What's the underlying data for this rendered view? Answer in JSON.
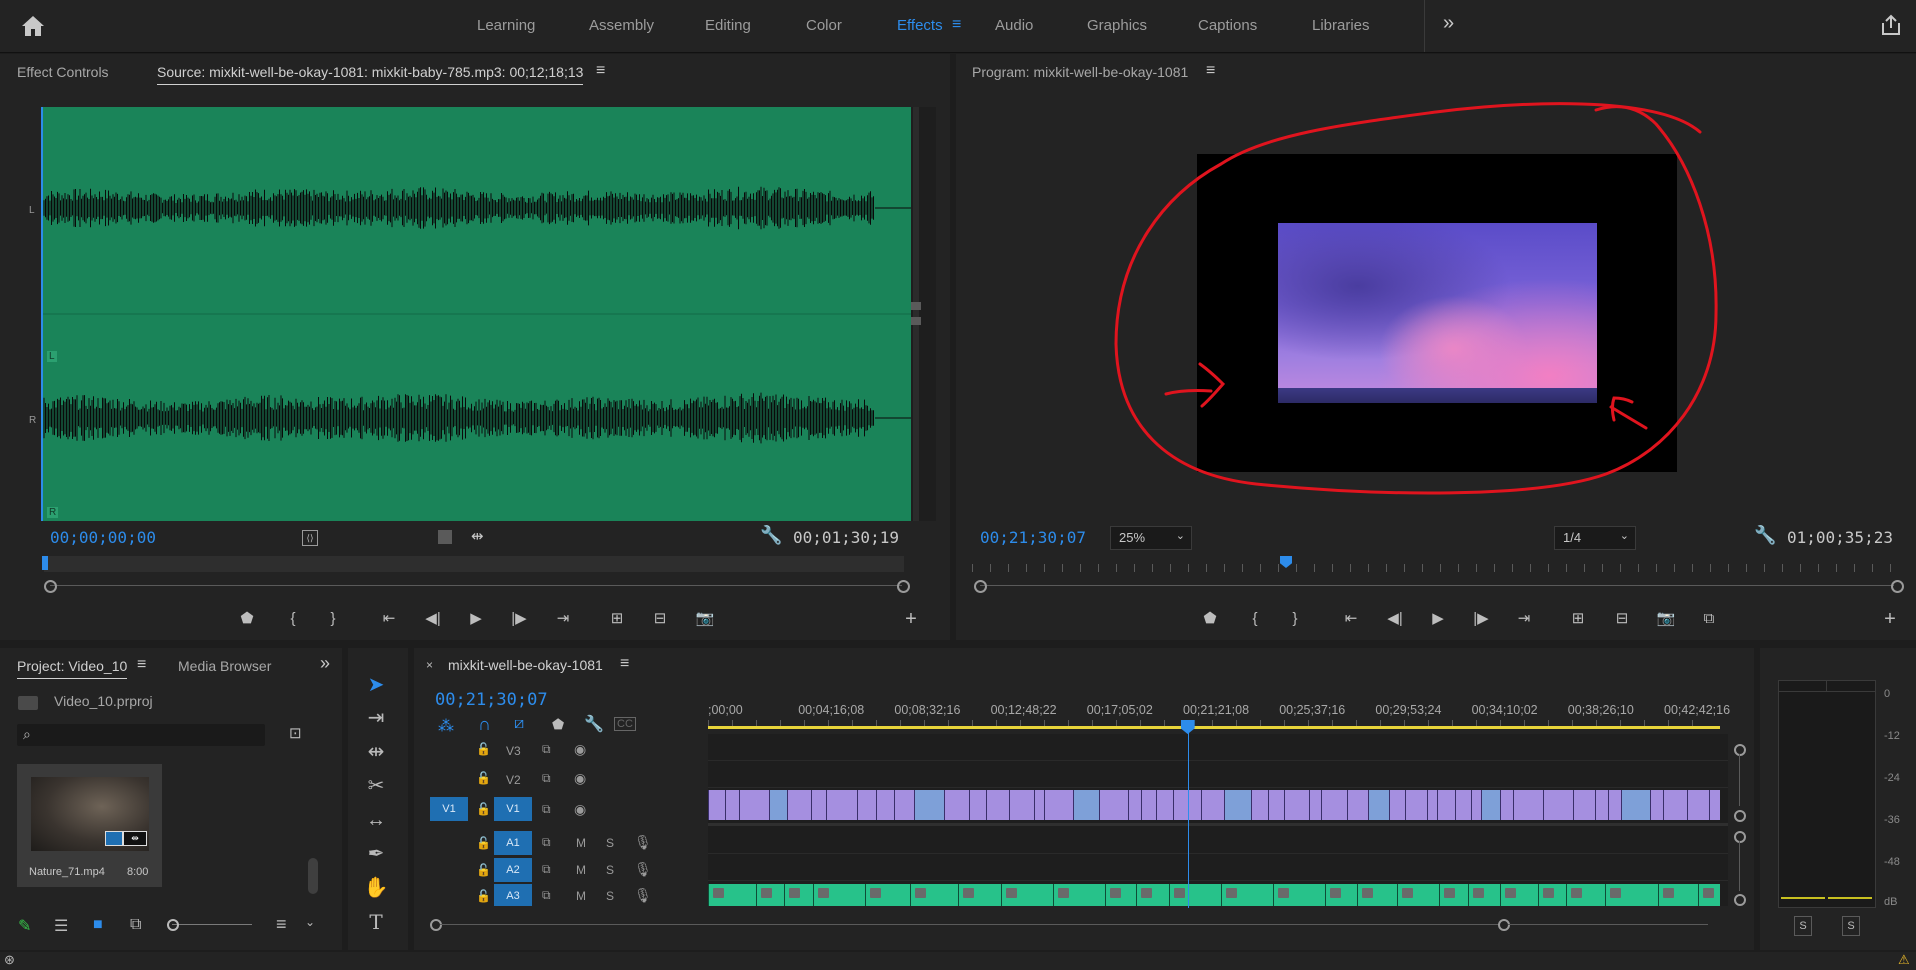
{
  "workspace": {
    "tabs": [
      {
        "label": "Learning"
      },
      {
        "label": "Assembly"
      },
      {
        "label": "Editing"
      },
      {
        "label": "Color"
      },
      {
        "label": "Effects"
      },
      {
        "label": "Audio"
      },
      {
        "label": "Graphics"
      },
      {
        "label": "Captions"
      },
      {
        "label": "Libraries"
      }
    ],
    "active_tab": "Effects",
    "overflow_icon": "double-chevron-right-icon"
  },
  "source_panel": {
    "tab_effect_controls": "Effect Controls",
    "tab_source": "Source: mixkit-well-be-okay-1081: mixkit-baby-785.mp3: 00;12;18;13",
    "channel_left": "L",
    "channel_right": "R",
    "timecode_current": "00;00;00;00",
    "timecode_duration": "00;01;30;19",
    "waveform_color": "#1a8459"
  },
  "program_panel": {
    "title": "Program: mixkit-well-be-okay-1081",
    "timecode_current": "00;21;30;07",
    "zoom": "25%",
    "resolution": "1/4",
    "timecode_duration": "01;00;35;23",
    "annotation_color": "#e0141e"
  },
  "project_panel": {
    "tab_project": "Project: Video_10",
    "tab_media_browser": "Media Browser",
    "project_file": "Video_10.prproj",
    "search_placeholder": "",
    "clip": {
      "name": "Nature_71.mp4",
      "duration": "8:00"
    }
  },
  "timeline": {
    "sequence_name": "mixkit-well-be-okay-1081",
    "timecode": "00;21;30;07",
    "ruler_labels": [
      ";00;00",
      "00;04;16;08",
      "00;08;32;16",
      "00;12;48;22",
      "00;17;05;02",
      "00;21;21;08",
      "00;25;37;16",
      "00;29;53;24",
      "00;34;10;02",
      "00;38;26;10",
      "00;42;42;16"
    ],
    "tracks": {
      "video": [
        {
          "name": "V3",
          "source": ""
        },
        {
          "name": "V2",
          "source": ""
        },
        {
          "name": "V1",
          "source": "V1"
        }
      ],
      "audio": [
        {
          "name": "A1",
          "mute": "M",
          "solo": "S"
        },
        {
          "name": "A2",
          "mute": "M",
          "solo": "S"
        },
        {
          "name": "A3",
          "mute": "M",
          "solo": "S"
        }
      ]
    },
    "video_clip_color": "#a58fe0",
    "audio_clip_color": "#27c28a",
    "playhead_fraction": 0.474
  },
  "audio_meter": {
    "scale": [
      "0",
      "-12",
      "-24",
      "-36",
      "-48",
      "dB"
    ],
    "solo_left": "S",
    "solo_right": "S"
  }
}
